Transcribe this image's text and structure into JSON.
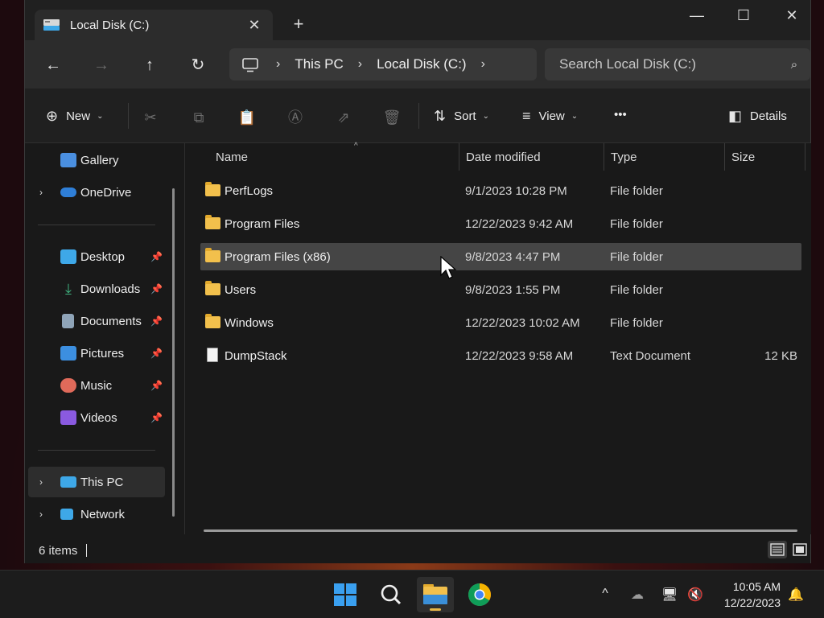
{
  "window": {
    "tab_title": "Local Disk (C:)",
    "tab_close": "✕",
    "new_tab": "+",
    "minimize": "—",
    "maximize": "☐",
    "close": "✕"
  },
  "nav": {
    "back": "←",
    "forward": "→",
    "up": "↑",
    "refresh": "↻",
    "breadcrumb": [
      "This PC",
      "Local Disk (C:)"
    ],
    "crumb_sep": "›",
    "search_placeholder": "Search Local Disk (C:)",
    "search_icon": "⌕"
  },
  "toolbar": {
    "new_label": "New",
    "sort_label": "Sort",
    "view_label": "View",
    "more_label": "•••",
    "details_label": "Details",
    "icons": {
      "new": "⊕",
      "cut": "✂",
      "copy": "⧉",
      "paste": "📋",
      "rename": "Ⓐ",
      "share": "⇗",
      "delete": "🗑",
      "sort": "⇅",
      "view": "≡",
      "details": "◧",
      "chevron": "⌄"
    }
  },
  "sidebar": {
    "items": [
      {
        "label": "Gallery",
        "icon": "gallery-icon",
        "color": "#4a8fe0"
      },
      {
        "label": "OneDrive",
        "icon": "onedrive-icon",
        "color": "#2f7fd8"
      },
      {
        "label": "Desktop",
        "icon": "desktop-icon",
        "color": "#3ea8e8"
      },
      {
        "label": "Downloads",
        "icon": "downloads-icon",
        "color": "#3fb27f"
      },
      {
        "label": "Documents",
        "icon": "documents-icon",
        "color": "#8fa4b8"
      },
      {
        "label": "Pictures",
        "icon": "pictures-icon",
        "color": "#3c8fe0"
      },
      {
        "label": "Music",
        "icon": "music-icon",
        "color": "#e06a5a"
      },
      {
        "label": "Videos",
        "icon": "videos-icon",
        "color": "#8a5ae0"
      },
      {
        "label": "This PC",
        "icon": "this-pc-icon",
        "color": "#3ea8e8"
      },
      {
        "label": "Network",
        "icon": "network-icon",
        "color": "#3ea8e8"
      }
    ],
    "expander": "›",
    "pin": "📌"
  },
  "columns": {
    "name": "Name",
    "date": "Date modified",
    "type": "Type",
    "size": "Size",
    "sort_arrow": "^"
  },
  "files": [
    {
      "name": "PerfLogs",
      "date": "9/1/2023 10:28 PM",
      "type": "File folder",
      "size": ""
    },
    {
      "name": "Program Files",
      "date": "12/22/2023 9:42 AM",
      "type": "File folder",
      "size": ""
    },
    {
      "name": "Program Files (x86)",
      "date": "9/8/2023 4:47 PM",
      "type": "File folder",
      "size": ""
    },
    {
      "name": "Users",
      "date": "9/8/2023 1:55 PM",
      "type": "File folder",
      "size": ""
    },
    {
      "name": "Windows",
      "date": "12/22/2023 10:02 AM",
      "type": "File folder",
      "size": ""
    },
    {
      "name": "DumpStack",
      "date": "12/22/2023 9:58 AM",
      "type": "Text Document",
      "size": "12 KB"
    }
  ],
  "status": {
    "item_count": "6 items"
  },
  "taskbar": {
    "time": "10:05 AM",
    "date": "12/22/2023",
    "tray": {
      "chevron": "^",
      "onedrive": "☁",
      "network": "🖥",
      "volume": "🔇",
      "bell": "🔔"
    }
  },
  "colors": {
    "folder": "#f2c04c",
    "accent": "#e7b84a",
    "selected_row": "#454545"
  }
}
